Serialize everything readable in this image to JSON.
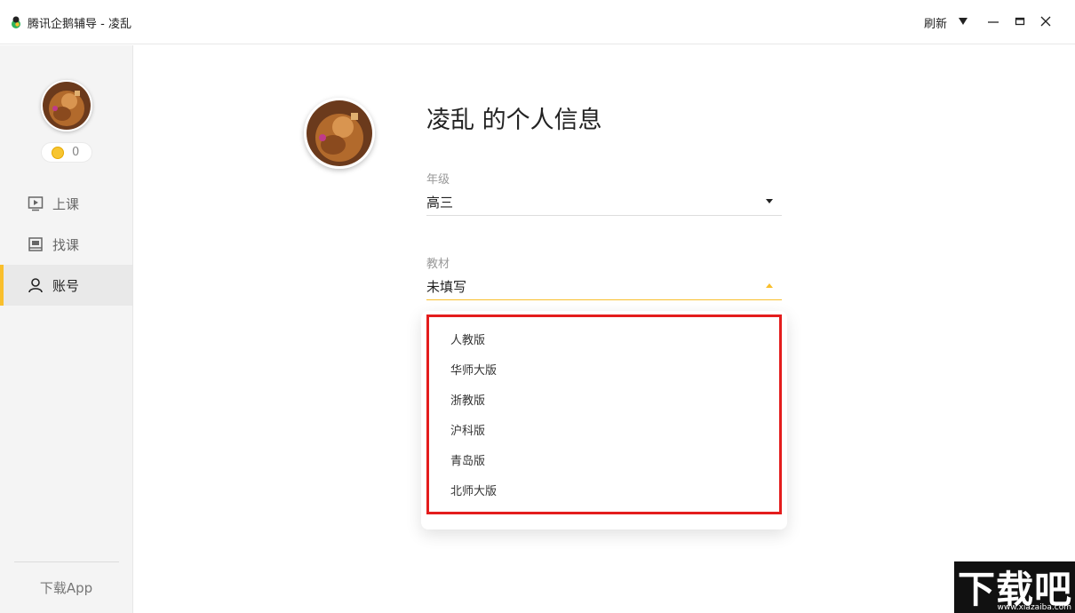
{
  "window": {
    "title": "腾讯企鹅辅导 - 凌乱",
    "refresh_label": "刷新"
  },
  "sidebar": {
    "coin_count": "0",
    "items": [
      {
        "label": "上课",
        "icon": "play-screen-icon"
      },
      {
        "label": "找课",
        "icon": "book-icon"
      },
      {
        "label": "账号",
        "icon": "user-icon"
      }
    ],
    "active_item": "账号",
    "download_label": "下载App"
  },
  "profile": {
    "title": "凌乱 的个人信息",
    "grade": {
      "label": "年级",
      "value": "高三"
    },
    "textbook": {
      "label": "教材",
      "value": "未填写"
    },
    "textbook_options": [
      "人教版",
      "华师大版",
      "浙教版",
      "沪科版",
      "青岛版",
      "北师大版"
    ]
  },
  "watermark": {
    "text": "下载吧",
    "url": "www.xiazaiba.com"
  },
  "colors": {
    "accent": "#f9bf2c",
    "highlight_border": "#e41d1d",
    "sidebar_bg": "#f4f4f4"
  }
}
